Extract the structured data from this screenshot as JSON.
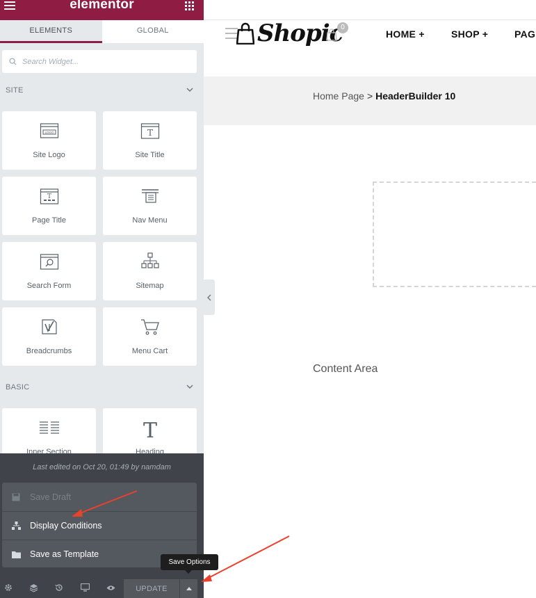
{
  "colors": {
    "brand": "#8f1d43",
    "panel_bg": "#e6e9ec",
    "footer_bg": "#404349",
    "annotation_arrow": "#e8412c"
  },
  "topbar": {
    "brand": "elementor",
    "menu_icon": "hamburger-icon",
    "apps_icon": "grid-icon"
  },
  "tabs": [
    {
      "label": "ELEMENTS",
      "active": true
    },
    {
      "label": "GLOBAL",
      "active": false
    }
  ],
  "search": {
    "placeholder": "Search Widget..."
  },
  "categories": {
    "site": "SITE",
    "basic": "BASIC"
  },
  "site_widgets": [
    {
      "label": "Site Logo",
      "icon": "site-logo-icon"
    },
    {
      "label": "Site Title",
      "icon": "site-title-icon"
    },
    {
      "label": "Page Title",
      "icon": "page-title-icon"
    },
    {
      "label": "Nav Menu",
      "icon": "nav-menu-icon"
    },
    {
      "label": "Search Form",
      "icon": "search-form-icon"
    },
    {
      "label": "Sitemap",
      "icon": "sitemap-icon"
    },
    {
      "label": "Breadcrumbs",
      "icon": "breadcrumbs-icon"
    },
    {
      "label": "Menu Cart",
      "icon": "menu-cart-icon"
    }
  ],
  "basic_widgets": [
    {
      "label": "Inner Section",
      "icon": "inner-section-icon"
    },
    {
      "label": "Heading",
      "icon": "heading-icon"
    }
  ],
  "footer": {
    "last_edited": "Last edited on Oct 20, 01:49 by namdam",
    "menu": [
      {
        "label": "Save Draft",
        "icon": "save-icon",
        "disabled": true
      },
      {
        "label": "Display Conditions",
        "icon": "conditions-icon",
        "disabled": false
      },
      {
        "label": "Save as Template",
        "icon": "folder-icon",
        "disabled": false
      }
    ],
    "update_label": "UPDATE",
    "tooltip": "Save Options"
  },
  "site": {
    "logo_text": "Shopic",
    "cart_count": "0",
    "nav": [
      "HOME +",
      "SHOP +",
      "PAG"
    ],
    "breadcrumb": {
      "home": "Home Page",
      "separator": ">",
      "current": "HeaderBuilder 10"
    },
    "content_area": "Content Area"
  }
}
